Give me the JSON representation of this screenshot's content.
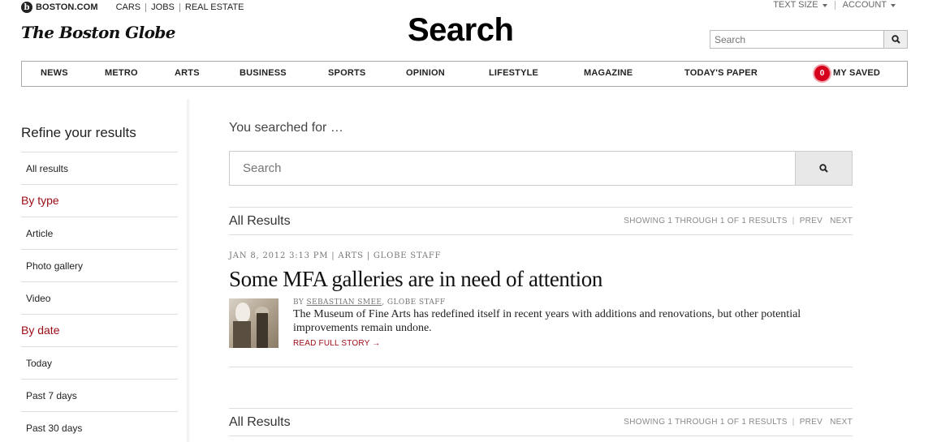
{
  "topbar": {
    "brand": "BOSTON.COM",
    "brand_letter": "b",
    "links": [
      "CARS",
      "JOBS",
      "REAL ESTATE"
    ],
    "text_size": "TEXT SIZE",
    "account": "ACCOUNT"
  },
  "logo": "The Boston Globe",
  "page_heading": "Search",
  "top_search": {
    "placeholder": "Search"
  },
  "nav": {
    "items": [
      "NEWS",
      "METRO",
      "ARTS",
      "BUSINESS",
      "SPORTS",
      "OPINION",
      "LIFESTYLE",
      "MAGAZINE",
      "TODAY'S PAPER"
    ],
    "saved_count": "0",
    "saved_label": "MY SAVED"
  },
  "sidebar": {
    "title": "Refine your results",
    "all_results": "All results",
    "by_type": "By type",
    "type_items": [
      "Article",
      "Photo gallery",
      "Video"
    ],
    "by_date": "By date",
    "date_items": [
      "Today",
      "Past 7 days",
      "Past 30 days"
    ]
  },
  "main": {
    "searched_for": "You searched for …",
    "search_placeholder": "Search",
    "results_label": "All Results",
    "showing": "SHOWING 1 THROUGH 1 OF 1 RESULTS",
    "prev": "PREV",
    "next": "NEXT",
    "result": {
      "meta": "JAN 8, 2012 3:13 PM | ARTS | GLOBE STAFF",
      "headline": "Some MFA galleries are in need of attention",
      "by_prefix": "BY ",
      "author": "SEBASTIAN SMEE",
      "by_suffix": ", GLOBE STAFF",
      "summary": "The Museum of Fine Arts has redefined itself in recent years with additions and renovations, but other potential improvements remain undone.",
      "read_more": "READ FULL STORY →"
    }
  },
  "colors": {
    "accent_red": "#9b0a14",
    "badge_red": "#d6001c"
  }
}
